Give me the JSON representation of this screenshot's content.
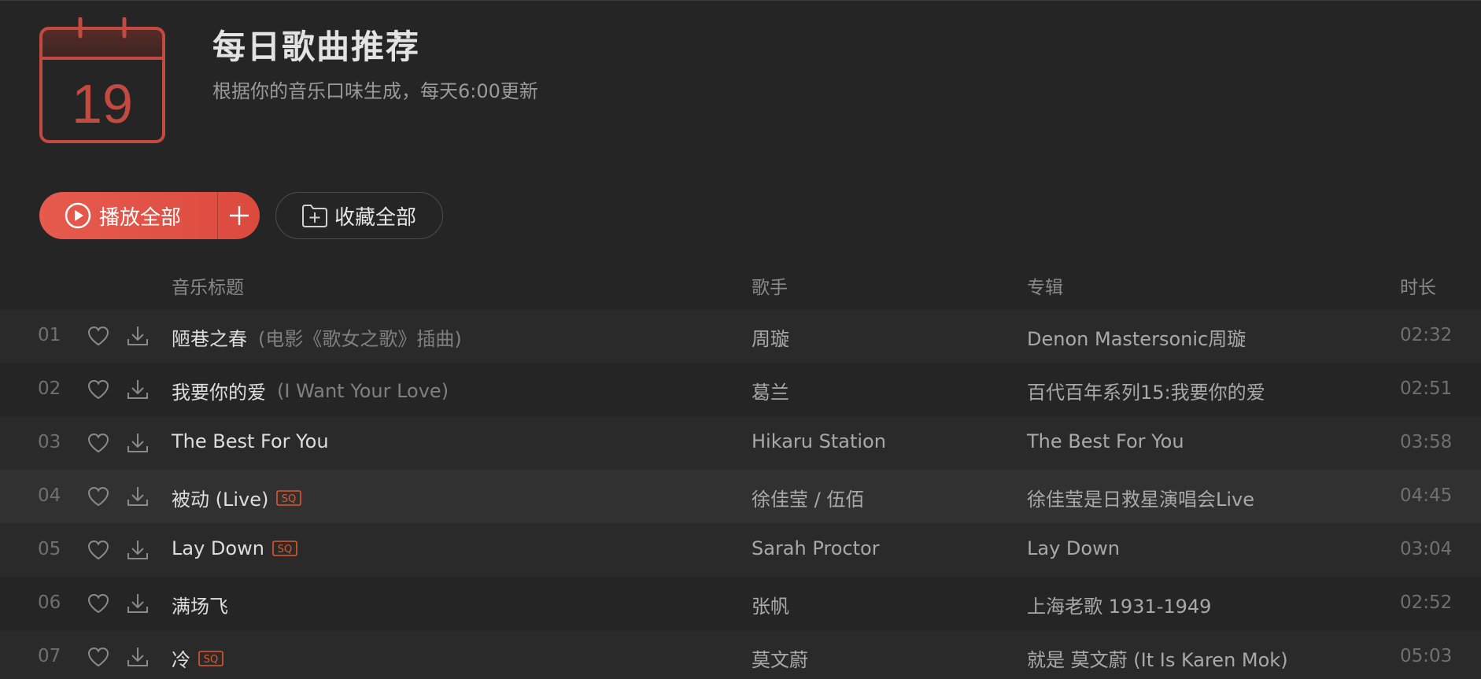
{
  "header": {
    "calendar_day": "19",
    "title": "每日歌曲推荐",
    "subtitle": "根据你的音乐口味生成，每天6:00更新"
  },
  "actions": {
    "play_all_label": "播放全部",
    "collect_all_label": "收藏全部"
  },
  "columns": {
    "title": "音乐标题",
    "artist": "歌手",
    "album": "专辑",
    "duration": "时长"
  },
  "colors": {
    "accent": "#dc4a3e",
    "background": "#252525",
    "sq_badge": "#e0592a"
  },
  "tracks": [
    {
      "index": "01",
      "title": "陋巷之春",
      "subtitle": "(电影《歌女之歌》插曲)",
      "sq": false,
      "artist": "周璇",
      "album": "Denon Mastersonic周璇",
      "duration": "02:32"
    },
    {
      "index": "02",
      "title": "我要你的爱",
      "subtitle": "(I Want Your Love)",
      "sq": false,
      "artist": "葛兰",
      "album": "百代百年系列15:我要你的爱",
      "duration": "02:51"
    },
    {
      "index": "03",
      "title": "The Best For You",
      "subtitle": "",
      "sq": false,
      "artist": "Hikaru Station",
      "album": "The Best For You",
      "duration": "03:58"
    },
    {
      "index": "04",
      "title": "被动 (Live)",
      "subtitle": "",
      "sq": true,
      "artist": "徐佳莹 / 伍佰",
      "album": "徐佳莹是日救星演唱会Live",
      "duration": "04:45"
    },
    {
      "index": "05",
      "title": "Lay Down",
      "subtitle": "",
      "sq": true,
      "artist": "Sarah Proctor",
      "album": "Lay Down",
      "duration": "03:04"
    },
    {
      "index": "06",
      "title": "满场飞",
      "subtitle": "",
      "sq": false,
      "artist": "张帆",
      "album": "上海老歌 1931-1949",
      "duration": "02:52"
    },
    {
      "index": "07",
      "title": "冷",
      "subtitle": "",
      "sq": true,
      "artist": "莫文蔚",
      "album": "就是 莫文蔚 (It Is Karen Mok)",
      "duration": "05:03"
    }
  ]
}
